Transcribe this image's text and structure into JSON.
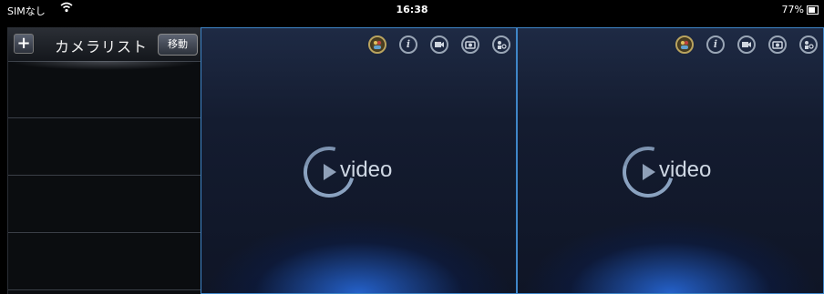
{
  "status_bar": {
    "carrier": "SIMなし",
    "wifi_icon": "wifi-icon",
    "time": "16:38",
    "battery": "77%"
  },
  "sidebar": {
    "title": "カメラリスト",
    "add_label": "+",
    "move_label": "移動"
  },
  "video_panes": [
    {
      "logo_text": "video",
      "toolbar_icons": [
        "people-icon",
        "info-icon",
        "record-icon",
        "snapshot-icon",
        "voice-icon"
      ],
      "info_glyph": "i"
    },
    {
      "logo_text": "video",
      "toolbar_icons": [
        "people-icon",
        "info-icon",
        "record-icon",
        "snapshot-icon",
        "voice-icon"
      ],
      "info_glyph": "i"
    }
  ]
}
